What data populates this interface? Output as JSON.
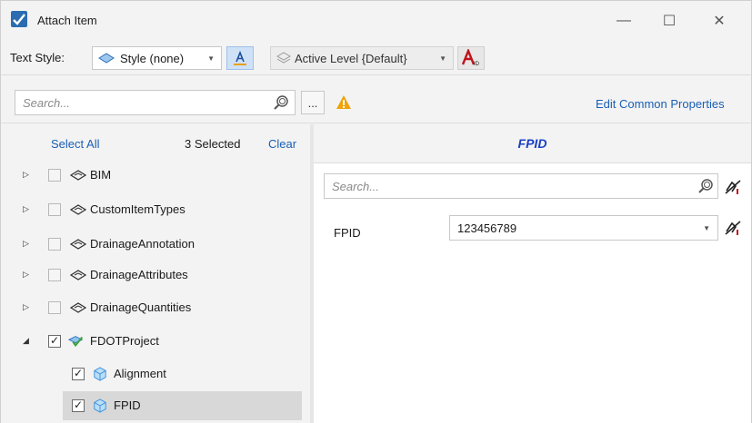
{
  "window": {
    "title": "Attach Item",
    "minimize_glyph": "—",
    "maximize_glyph": "☐",
    "close_glyph": "✕"
  },
  "toolbar": {
    "text_style_label": "Text Style:",
    "style_value": "Style (none)",
    "level_value": "Active Level {Default}",
    "combo_arrow": "▼"
  },
  "search": {
    "placeholder": "Search...",
    "more_label": "...",
    "edit_common_label": "Edit Common Properties"
  },
  "tree": {
    "select_all_label": "Select All",
    "selected_count_label": "3 Selected",
    "clear_label": "Clear",
    "nodes": [
      {
        "label": "BIM",
        "level": 0,
        "expanded": false,
        "checked": false
      },
      {
        "label": "CustomItemTypes",
        "level": 0,
        "expanded": false,
        "checked": false
      },
      {
        "label": "DrainageAnnotation",
        "level": 0,
        "expanded": false,
        "checked": false
      },
      {
        "label": "DrainageAttributes",
        "level": 0,
        "expanded": false,
        "checked": false
      },
      {
        "label": "DrainageQuantities",
        "level": 0,
        "expanded": false,
        "checked": false
      },
      {
        "label": "FDOTProject",
        "level": 0,
        "expanded": true,
        "checked": true
      },
      {
        "label": "Alignment",
        "level": 1,
        "checked": true
      },
      {
        "label": "FPID",
        "level": 1,
        "checked": true,
        "selected": true
      }
    ],
    "expand_glyph": "▷",
    "collapse_glyph": "◢",
    "check_glyph": "✓"
  },
  "properties": {
    "title": "FPID",
    "search_placeholder": "Search...",
    "rows": [
      {
        "label": "FPID",
        "value": "123456789"
      }
    ]
  },
  "colors": {
    "link": "#1a5fb4",
    "panel_title": "#1a3fc4",
    "warning": "#f0a30a",
    "selection": "#d8d8d8",
    "style_button": "#cfe1f7"
  }
}
